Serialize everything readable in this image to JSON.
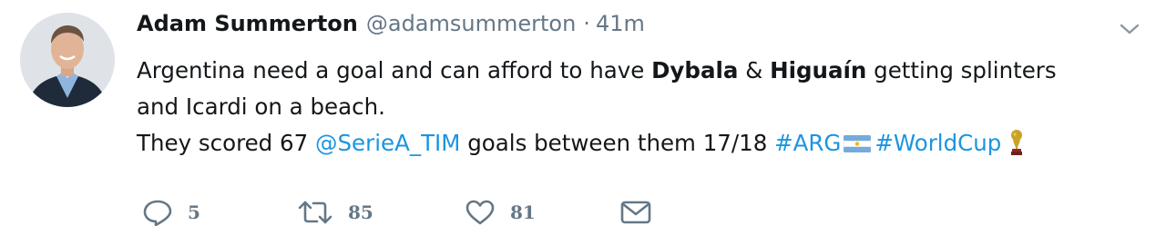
{
  "author": {
    "name": "Adam Summerton",
    "handle": "@adamsummerton",
    "separator": "·",
    "time": "41m"
  },
  "tweet": {
    "line1_a": "Argentina need a goal and can afford to have ",
    "line1_b": "Dybala",
    "line1_c": " & ",
    "line1_d": "Higuaín",
    "line1_e": " getting splinters",
    "line2": "and Icardi on a beach.",
    "line3_a": "They scored 67 ",
    "mention": "@SerieA_TIM",
    "line3_b": " goals between them 17/18 ",
    "hashtag1": "#ARG",
    "hashtag2": "#WorldCup",
    "emoji": [
      "argentina-flag-icon",
      "trophy-icon"
    ]
  },
  "actions": {
    "replies": "5",
    "retweets": "85",
    "likes": "81"
  },
  "colors": {
    "text": "#14171a",
    "secondary": "#657786",
    "link": "#1b95e0"
  }
}
